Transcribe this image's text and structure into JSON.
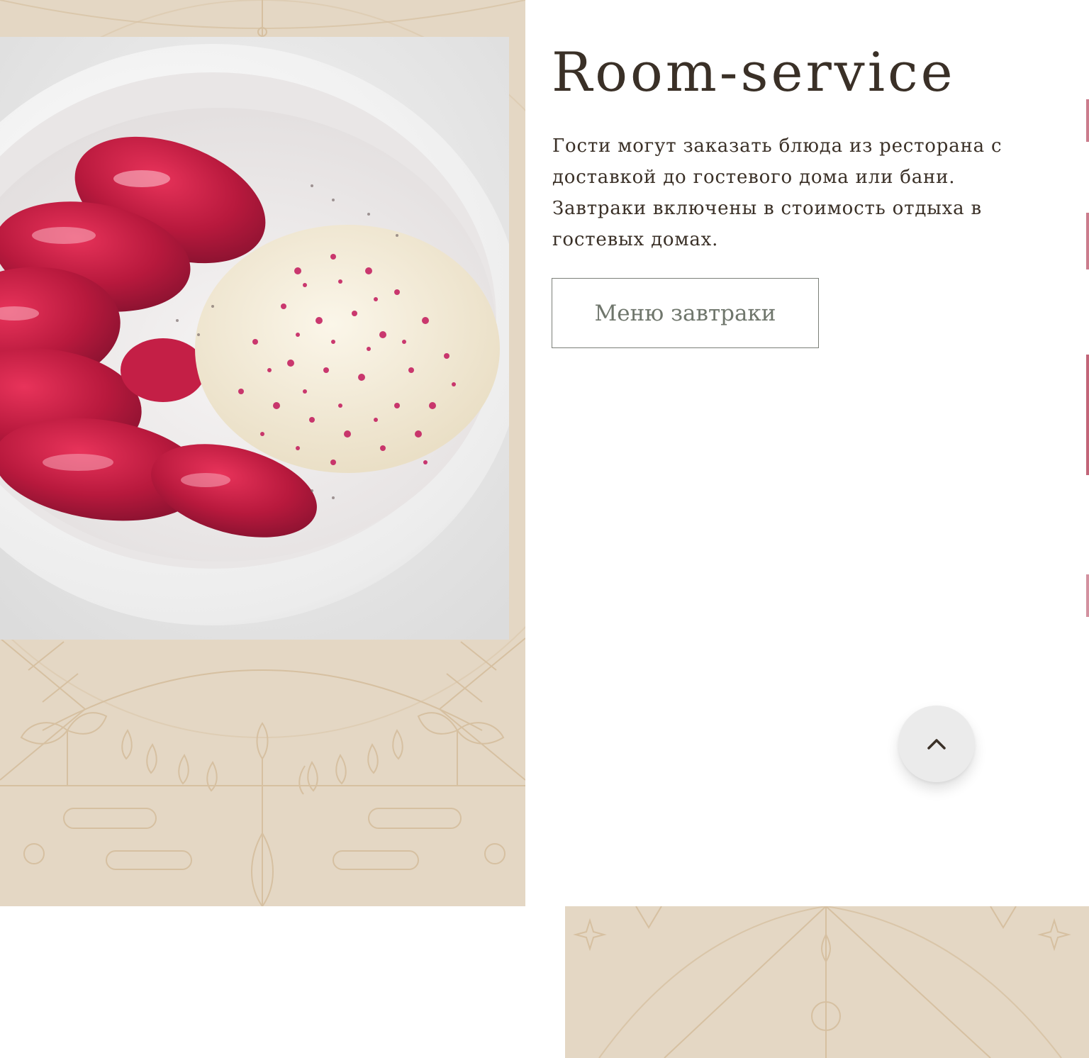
{
  "section": {
    "title": "Room-service",
    "description": "Гости могут заказать блюда из ресторана с доставкой до гостевого дома или бани. Завтраки включены в стоимость отдыха в гостевых домах.",
    "button_label": "Меню завтраки"
  },
  "photo": {
    "icon": "food-photo"
  },
  "scroll_top": {
    "icon": "chevron-up-icon"
  },
  "colors": {
    "pattern_bg": "#e4d7c4",
    "pattern_line": "#d8c3a6",
    "text": "#3a3027",
    "button_text": "#6f766c",
    "button_border": "#7b7f78"
  }
}
